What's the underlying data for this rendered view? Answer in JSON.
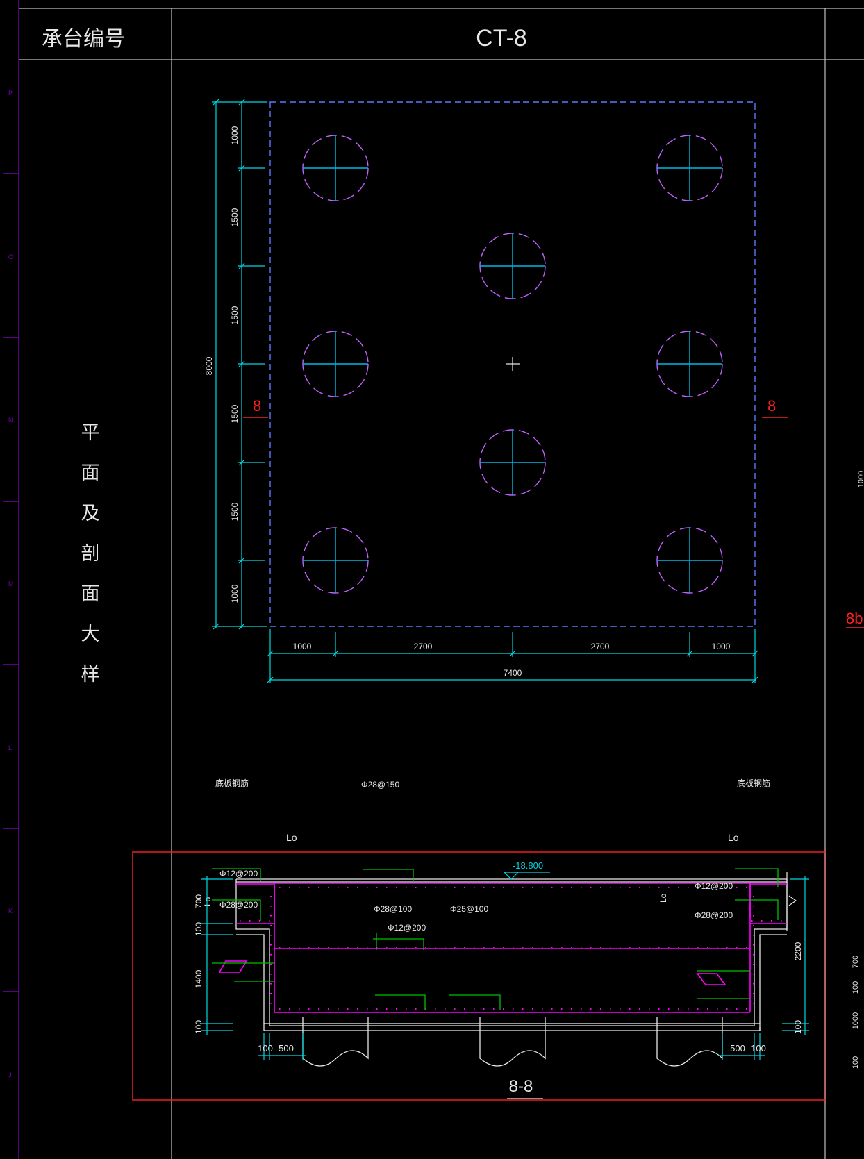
{
  "title_block": {
    "label_left": "承台编号",
    "cap_id": "CT-8",
    "side_title": [
      "平",
      "面",
      "及",
      "剖",
      "面",
      "大",
      "样"
    ]
  },
  "grid_letters": [
    "P",
    "O",
    "N",
    "M",
    "L",
    "K",
    "J"
  ],
  "plan": {
    "left_dims": [
      "1000",
      "1500",
      "1500",
      "1500",
      "1500",
      "1000"
    ],
    "total_height": "8000",
    "bottom_dims": [
      "1000",
      "2700",
      "2700",
      "1000"
    ],
    "total_width": "7400",
    "section_mark": "8"
  },
  "section": {
    "top_labels": {
      "bottom_rebar_left": "底板钢筋",
      "rebar_main": "Φ28@150",
      "bottom_rebar_right": "底板钢筋",
      "lo_left": "Lo",
      "lo_right": "Lo"
    },
    "elevation": "-18.800",
    "rebar": {
      "r1": "Φ12@200",
      "r2": "Φ28@200",
      "r3": "Φ28@100",
      "r4": "Φ25@100",
      "r5": "Φ12@200",
      "r6": "Φ12@200",
      "r7": "Φ28@200",
      "lo_inner": "Lo"
    },
    "left_dims": [
      "700",
      "100",
      "1400",
      "100"
    ],
    "lo_rotated": "Lo",
    "right_total": "2200",
    "right_dim_bottom": "100",
    "bottom_left_dims": [
      "100",
      "500"
    ],
    "bottom_right_dims": [
      "500",
      "100"
    ],
    "title": "8-8"
  },
  "right_partial": {
    "dims": [
      "1000",
      "700",
      "100",
      "1000",
      "100"
    ],
    "section_mark": "8b"
  },
  "colors": {
    "frame": "#c0c0c0",
    "dimension": "#00d7e0",
    "pile": "#c060ff",
    "rebar_magenta": "#ff00ff",
    "rebar_green": "#00c000",
    "section_red": "#ff2020",
    "grid_purple": "#7a00b0"
  }
}
